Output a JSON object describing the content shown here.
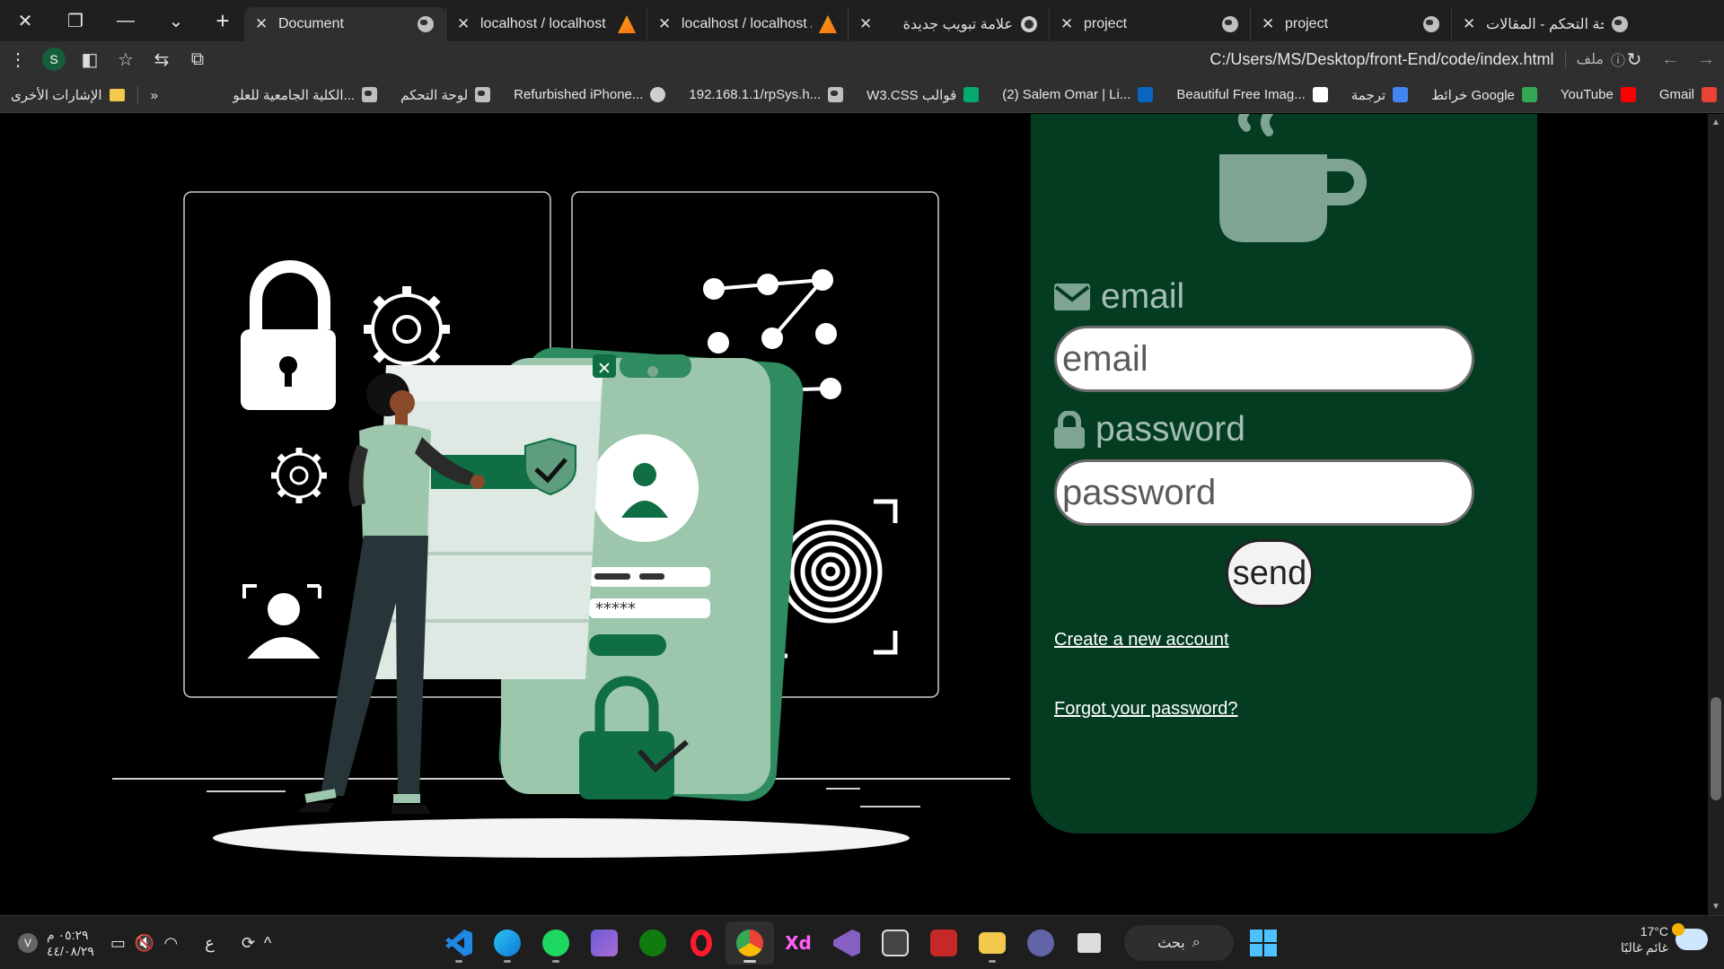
{
  "browser": {
    "tabs": [
      {
        "title": "Document",
        "favicon": "globe-icon",
        "active": true
      },
      {
        "title": "localhost / localhost |",
        "favicon": "phpmyadmin-icon"
      },
      {
        "title": "localhost / localhost /",
        "favicon": "phpmyadmin-icon"
      },
      {
        "title": "علامة تبويب جديدة",
        "favicon": "chrome-icon"
      },
      {
        "title": "project",
        "favicon": "globe-icon"
      },
      {
        "title": "project",
        "favicon": "globe-icon"
      },
      {
        "title": "لوحة التحكم - المقالات",
        "favicon": "globe-icon"
      }
    ],
    "address": "C:/Users/MS/Desktop/front-End/code/index.html",
    "address_chip": "ملف",
    "profile_initial": "S",
    "bookmarks": [
      {
        "label": "Gmail",
        "color": "#ea4335"
      },
      {
        "label": "YouTube",
        "color": "#ff0000"
      },
      {
        "label": "خرائط Google",
        "color": "#34a853"
      },
      {
        "label": "ترجمة",
        "color": "#4285f4"
      },
      {
        "label": "Beautiful Free Imag...",
        "color": "#ffffff"
      },
      {
        "label": "(2) Salem Omar | Li...",
        "color": "#0a66c2"
      },
      {
        "label": "W3.CSS قوالب",
        "color": "#04aa6d"
      },
      {
        "label": "192.168.1.1/rpSys.h...",
        "color": "#bfbfbf"
      },
      {
        "label": "Refurbished iPhone...",
        "color": "#bfbfbf"
      },
      {
        "label": "لوحة التحكم",
        "color": "#bfbfbf"
      },
      {
        "label": "الكلية الجامعية للعلو...",
        "color": "#bfbfbf"
      }
    ],
    "more_bookmarks": "»",
    "other_bookmarks": "الإشارات الأخرى"
  },
  "login": {
    "email_label": "email",
    "email_placeholder": "email",
    "password_label": "password",
    "password_placeholder": "password",
    "send_label": "send",
    "create_account_link": "Create a new account",
    "forgot_password_link": "Forgot your password?",
    "colors": {
      "card": "#033c21",
      "label": "#a7bfb3",
      "accent": "#7fa493"
    }
  },
  "illustration": {
    "password_mask": "*****"
  },
  "taskbar": {
    "time": "٠٥:٢٩ م",
    "date": "٤٤/٠٨/٢٩",
    "lang": "ع",
    "search_label": "بحث",
    "temperature": "17°C",
    "weather_text": "غائم غالبًا",
    "apps": [
      "vscode-icon",
      "edge-icon",
      "spotify-icon",
      "clipchamp-icon",
      "xbox-icon",
      "opera-icon",
      "chrome-icon",
      "xd-icon",
      "visual-studio-icon",
      "app-icon",
      "app-icon",
      "file-explorer-icon",
      "teams-icon",
      "task-view-icon"
    ]
  }
}
